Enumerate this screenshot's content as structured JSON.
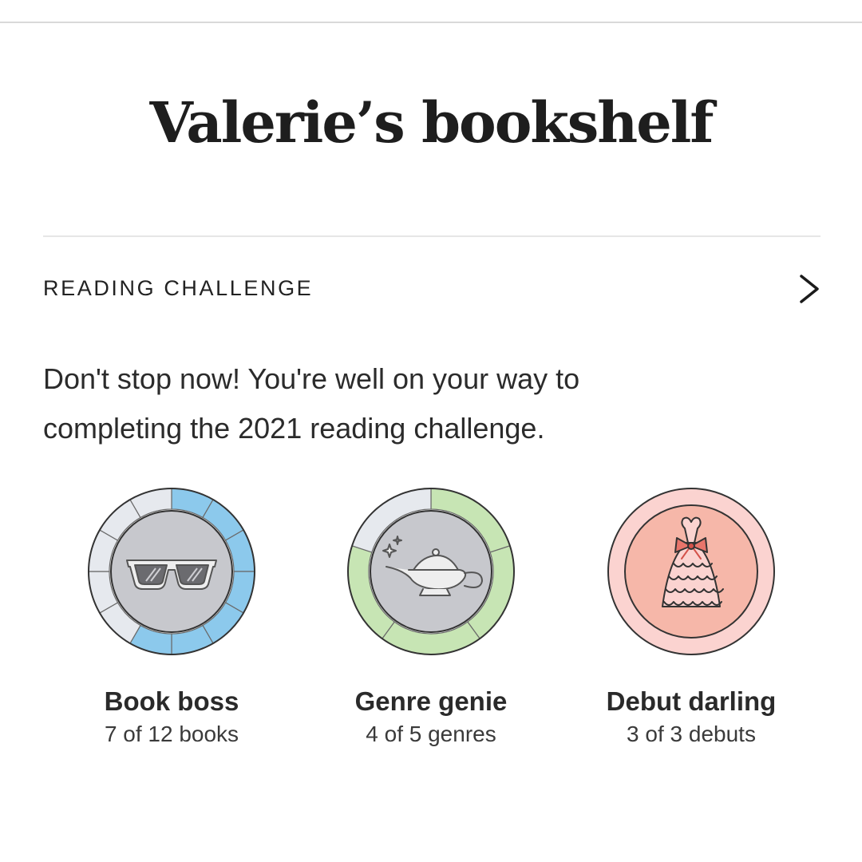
{
  "page": {
    "title": "Valerie’s bookshelf"
  },
  "reading_challenge": {
    "heading": "READING CHALLENGE",
    "chevron_icon": "chevron-right-icon",
    "message_line1": "Don't stop now! You're well on your way to",
    "message_line2": "completing the 2021 reading challenge."
  },
  "badges": [
    {
      "name": "Book boss",
      "progress": "7 of 12 books",
      "icon": "sunglasses-icon",
      "completed": 7,
      "total": 12,
      "accent": "#8cc9ec",
      "fill": "#c7c8cd"
    },
    {
      "name": "Genre genie",
      "progress": "4 of 5 genres",
      "icon": "magic-lamp-icon",
      "completed": 4,
      "total": 5,
      "accent": "#c7e5b4",
      "fill": "#c7c8cd"
    },
    {
      "name": "Debut darling",
      "progress": "3 of 3 debuts",
      "icon": "dress-icon",
      "completed": 3,
      "total": 3,
      "accent": "#fbd3d0",
      "fill": "#f6b7a9"
    }
  ]
}
